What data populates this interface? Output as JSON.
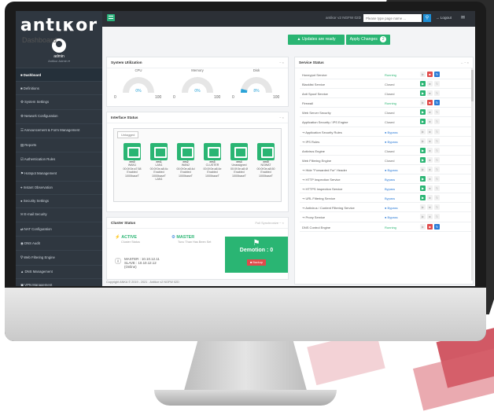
{
  "app": {
    "logo": "antικor",
    "user": "admin",
    "user_role": "Antikor Admin ▾"
  },
  "topbar": {
    "device": "antikor v2 NGFW 02D",
    "search_placeholder": "Please type page name ...",
    "search_icon": "search-icon",
    "logout": "→ Logout",
    "mail_icon": "✉"
  },
  "header": {
    "title": "Dashboard",
    "updates_label": "▲ Updates are ready",
    "apply_label": "Apply Changes",
    "apply_count": "2"
  },
  "sidebar": {
    "items": [
      "■ Dashboard",
      "■ Definitions",
      "⚙ System Settings",
      "⚙ Network Configuration",
      "☰ Announcement & Form Management",
      "▤ Reports",
      "☑ Authentication Rules",
      "⚑ Hotspot Management",
      "⌖ Instant Observation",
      "● Security Settings",
      "✉ E-mail Security",
      "⇄ NAT Configuration",
      "◉ DNS Audit",
      "∇ Web Filtering Engine",
      "▲ DNS Management",
      "▣ VPN Management",
      "≡ Routing Management",
      "⊘ Quarantine and Intrusion Detection System"
    ],
    "active_index": 0
  },
  "system_utilization": {
    "title": "System Utilization",
    "controls": "− ×",
    "gauges": [
      {
        "label": "CPU",
        "percent": "0%",
        "min": "0",
        "max": "100",
        "value": 0
      },
      {
        "label": "Memory",
        "percent": "0%",
        "min": "0",
        "max": "100",
        "value": 0
      },
      {
        "label": "Disk",
        "percent": "8%",
        "min": "0",
        "max": "100",
        "value": 8
      }
    ]
  },
  "interface_status": {
    "title": "Interface Status",
    "controls": "− ×",
    "untagged": "Untagged",
    "ports": [
      {
        "name": "em0",
        "type": "WAN1",
        "mac": "00:0f:0e:a7:58",
        "state": "Enabled",
        "speed": "1000baseT"
      },
      {
        "name": "em1",
        "type": "LAN1",
        "mac": "00:0f:0e:a8:4c",
        "state": "Enabled",
        "speed": "1000baseT"
      },
      {
        "name": "em2",
        "type": "WAN2",
        "mac": "00:0f:0e:a8:4d",
        "state": "Enabled",
        "speed": "1000baseT"
      },
      {
        "name": "em3",
        "type": "CLUSTER",
        "mac": "00:0f:0e:a8:4e",
        "state": "Enabled",
        "speed": "1000baseT"
      },
      {
        "name": "em4",
        "type": "Unassigned",
        "mac": "00:0f:0e:a8:4f",
        "state": "Enabled",
        "speed": "1000baseT"
      },
      {
        "name": "em5",
        "type": "NGWAT",
        "mac": "00:0f:0e:a8:50",
        "state": "Enabled",
        "speed": "1000baseT"
      }
    ],
    "extra": "LAN1"
  },
  "cluster_status": {
    "title": "Cluster Status",
    "controls": "Full Synchronize  − ×",
    "active": "ACTIVE",
    "active_sub": "Cluster Status",
    "master": "MASTER",
    "master_sub": "Tunc Than Has Been Set",
    "master_ip": "MASTER : 10.10.12.11",
    "slave_ip": "SLAVE : 10.10.12.12 (Online)",
    "demotion": "Demotion : 0",
    "backup": "■ Backup"
  },
  "copyright": "Copyright ANKA © 2019 - 2021 . Antikor v2 NGFW 02D",
  "service_status": {
    "title": "Service Status",
    "controls": "↔ − ×",
    "services": [
      {
        "name": "Honeypot Service",
        "status": "Running",
        "kind": "running"
      },
      {
        "name": "Blacklist Service",
        "status": "Closed",
        "kind": "closed"
      },
      {
        "name": "Anti Spoof Service",
        "status": "Closed",
        "kind": "closed"
      },
      {
        "name": "Firewall",
        "status": "Running",
        "kind": "running"
      },
      {
        "name": "Web Server Security",
        "status": "Closed",
        "kind": "closed"
      },
      {
        "name": "Application Security / IPS Engine",
        "status": "Closed",
        "kind": "closed"
      },
      {
        "name": "⇝ Application Security Rules",
        "status": "● Bypass",
        "kind": "bypass"
      },
      {
        "name": "⇝ IPS Rules",
        "status": "● Bypass",
        "kind": "bypass"
      },
      {
        "name": "Antivirus Engine",
        "status": "Closed",
        "kind": "closed"
      },
      {
        "name": "Web Filtering Engine",
        "status": "Closed",
        "kind": "closed"
      },
      {
        "name": "⇝ Hide \"Forwarded For\" Header",
        "status": "● Bypass",
        "kind": "bypass"
      },
      {
        "name": "⇝ HTTP Inspection Service",
        "status": "Bypass",
        "kind": "bypass"
      },
      {
        "name": "⇝ HTTPS Inspection Service",
        "status": "Bypass",
        "kind": "bypass"
      },
      {
        "name": "⇝ URL Filtering Service",
        "status": "Bypass",
        "kind": "bypass"
      },
      {
        "name": "⇝ Antivirus / Content Filtering Service",
        "status": "● Bypass",
        "kind": "bypass"
      },
      {
        "name": "⇝ Proxy Service",
        "status": "● Bypass",
        "kind": "bypass"
      },
      {
        "name": "DNS Control Engine",
        "status": "Running",
        "kind": "running"
      }
    ]
  }
}
